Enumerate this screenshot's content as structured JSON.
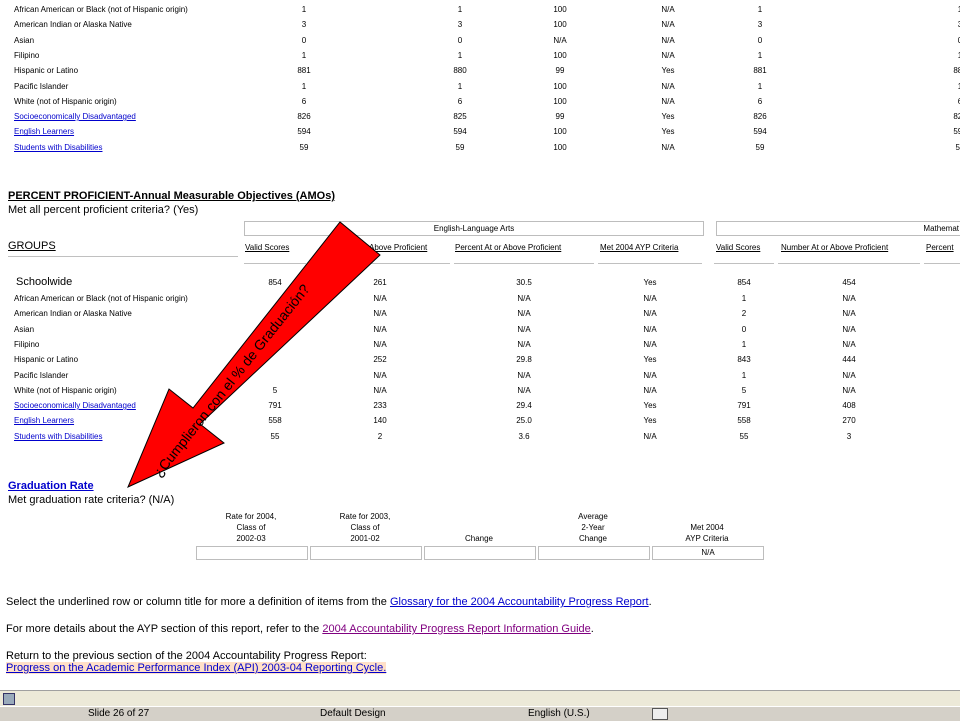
{
  "top_table": {
    "rows": [
      {
        "group": "African American or Black (not of Hispanic origin)",
        "c1": "1",
        "c2": "1",
        "c3": "100",
        "c4": "N/A",
        "c5": "1",
        "c6": "1",
        "link": false
      },
      {
        "group": "American Indian or Alaska Native",
        "c1": "3",
        "c2": "3",
        "c3": "100",
        "c4": "N/A",
        "c5": "3",
        "c6": "3",
        "link": false
      },
      {
        "group": "Asian",
        "c1": "0",
        "c2": "0",
        "c3": "N/A",
        "c4": "N/A",
        "c5": "0",
        "c6": "0",
        "link": false
      },
      {
        "group": "Filipino",
        "c1": "1",
        "c2": "1",
        "c3": "100",
        "c4": "N/A",
        "c5": "1",
        "c6": "1",
        "link": false
      },
      {
        "group": "Hispanic or Latino",
        "c1": "881",
        "c2": "880",
        "c3": "99",
        "c4": "Yes",
        "c5": "881",
        "c6": "881",
        "link": false
      },
      {
        "group": "Pacific Islander",
        "c1": "1",
        "c2": "1",
        "c3": "100",
        "c4": "N/A",
        "c5": "1",
        "c6": "1",
        "link": false
      },
      {
        "group": "White (not of Hispanic origin)",
        "c1": "6",
        "c2": "6",
        "c3": "100",
        "c4": "N/A",
        "c5": "6",
        "c6": "6",
        "link": false
      },
      {
        "group": "Socioeconomically Disadvantaged",
        "c1": "826",
        "c2": "825",
        "c3": "99",
        "c4": "Yes",
        "c5": "826",
        "c6": "826",
        "link": true
      },
      {
        "group": "English Learners",
        "c1": "594",
        "c2": "594",
        "c3": "100",
        "c4": "Yes",
        "c5": "594",
        "c6": "594",
        "link": true
      },
      {
        "group": "Students with Disabilities",
        "c1": "59",
        "c2": "59",
        "c3": "100",
        "c4": "N/A",
        "c5": "59",
        "c6": "59",
        "link": true
      }
    ]
  },
  "amo": {
    "title": "PERCENT PROFICIENT-Annual Measurable Objectives (AMOs)",
    "criteria": "Met all percent proficient criteria? (Yes)",
    "ela_header": "English-Language Arts",
    "math_header": "Mathemat",
    "groups_label": "GROUPS",
    "col_valid": "Valid Scores",
    "col_number": "Number At or Above Proficient",
    "col_number_partial": "/ Above Proficient",
    "col_percent": "Percent At or Above Proficient",
    "col_met": "Met 2004 AYP Criteria",
    "col_valid2": "Valid Scores",
    "col_number2": "Number At or Above Proficient",
    "col_percent2": "Percent",
    "schoolwide": {
      "label": "Schoolwide",
      "valid": "854",
      "num": "261",
      "pct": "30.5",
      "met": "Yes",
      "valid2": "854",
      "num2": "454"
    },
    "rows": [
      {
        "group": "African American or Black (not of Hispanic origin)",
        "valid": "",
        "num": "N/A",
        "pct": "N/A",
        "met": "N/A",
        "valid2": "1",
        "num2": "N/A",
        "link": false
      },
      {
        "group": "American Indian or Alaska Native",
        "valid": "",
        "num": "N/A",
        "pct": "N/A",
        "met": "N/A",
        "valid2": "2",
        "num2": "N/A",
        "link": false
      },
      {
        "group": "Asian",
        "valid": "",
        "num": "N/A",
        "pct": "N/A",
        "met": "N/A",
        "valid2": "0",
        "num2": "N/A",
        "link": false
      },
      {
        "group": "Filipino",
        "valid": "",
        "num": "N/A",
        "pct": "N/A",
        "met": "N/A",
        "valid2": "1",
        "num2": "N/A",
        "link": false
      },
      {
        "group": "Hispanic or Latino",
        "valid": "",
        "num": "252",
        "pct": "29.8",
        "met": "Yes",
        "valid2": "843",
        "num2": "444",
        "link": false
      },
      {
        "group": "Pacific Islander",
        "valid": "",
        "num": "N/A",
        "pct": "N/A",
        "met": "N/A",
        "valid2": "1",
        "num2": "N/A",
        "link": false
      },
      {
        "group": "White (not of Hispanic origin)",
        "valid": "5",
        "num": "N/A",
        "pct": "N/A",
        "met": "N/A",
        "valid2": "5",
        "num2": "N/A",
        "link": false
      },
      {
        "group": "Socioeconomically Disadvantaged",
        "valid": "791",
        "num": "233",
        "pct": "29.4",
        "met": "Yes",
        "valid2": "791",
        "num2": "408",
        "link": true
      },
      {
        "group": "English Learners",
        "valid": "558",
        "num": "140",
        "pct": "25.0",
        "met": "Yes",
        "valid2": "558",
        "num2": "270",
        "link": true
      },
      {
        "group": "Students with Disabilities",
        "valid": "55",
        "num": "2",
        "pct": "3.6",
        "met": "N/A",
        "valid2": "55",
        "num2": "3",
        "link": true
      }
    ]
  },
  "graduation": {
    "title": "Graduation Rate",
    "criteria": "Met graduation rate criteria? (N/A)",
    "col1": [
      "Rate for 2004,",
      "Class of",
      "2002-03"
    ],
    "col2": [
      "Rate for 2003,",
      "Class of",
      "2001-02"
    ],
    "col3": [
      "Change"
    ],
    "col4": [
      "Average",
      "2-Year",
      "Change"
    ],
    "col5": [
      "Met 2004",
      "AYP Criteria"
    ],
    "met_value": "N/A"
  },
  "footer": {
    "line1_prefix": "Select the underlined row or column title for more a definition of items from the ",
    "line1_link": "Glossary for the 2004 Accountability Progress Report",
    "line1_suffix": ".",
    "line2_prefix": "For more details about the AYP section of this report, refer to the ",
    "line2_link": "2004 Accountability Progress Report Information Guide",
    "line2_suffix": ".",
    "line3": "Return to the previous section of the 2004 Accountability Progress Report:",
    "line4_link": "Progress on the Academic Performance Index (API) 2003-04 Reporting Cycle."
  },
  "annotation": {
    "text": "¿Cumplieron con el % de Graduación?",
    "color": "#ff0000"
  },
  "status_bar": {
    "slide": "Slide 26 of 27",
    "design": "Default Design",
    "language": "English (U.S.)"
  }
}
